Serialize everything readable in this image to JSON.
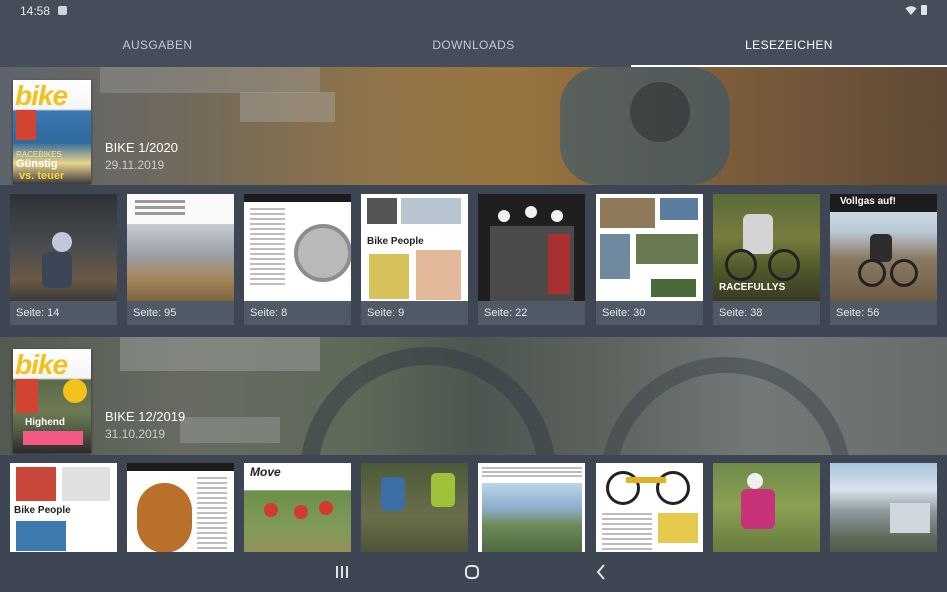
{
  "status": {
    "time": "14:58"
  },
  "tabs": [
    {
      "label": "AUSGABEN"
    },
    {
      "label": "DOWNLOADS"
    },
    {
      "label": "LESEZEICHEN",
      "active": true
    }
  ],
  "cover_texts": {
    "logo": "bike",
    "issue1_headline_1": "Günstig",
    "issue1_headline_2": "vs. teuer",
    "issue1_tag": "RACEBIKES",
    "issue2_headline": "Highend"
  },
  "page_texts": {
    "people": "Bike People",
    "racefullys": "RACEFULLYS",
    "vollgas": "Vollgas auf!",
    "move": "Move"
  },
  "issues": [
    {
      "title": "BIKE 1/2020",
      "date": "29.11.2019",
      "bookmarks": [
        {
          "label": "Seite: 14"
        },
        {
          "label": "Seite: 95"
        },
        {
          "label": "Seite: 8"
        },
        {
          "label": "Seite: 9"
        },
        {
          "label": "Seite: 22"
        },
        {
          "label": "Seite: 30"
        },
        {
          "label": "Seite: 38"
        },
        {
          "label": "Seite: 56"
        }
      ]
    },
    {
      "title": "BIKE 12/2019",
      "date": "31.10.2019",
      "bookmarks": [
        {
          "label": ""
        },
        {
          "label": ""
        },
        {
          "label": ""
        },
        {
          "label": ""
        },
        {
          "label": ""
        },
        {
          "label": ""
        },
        {
          "label": ""
        },
        {
          "label": ""
        }
      ]
    }
  ],
  "colors": {
    "background": "#3d4652",
    "bar": "#444d59",
    "accent": "#f2c21b"
  },
  "nav": {
    "icons": [
      "recent-apps-icon",
      "home-icon",
      "back-icon"
    ]
  }
}
